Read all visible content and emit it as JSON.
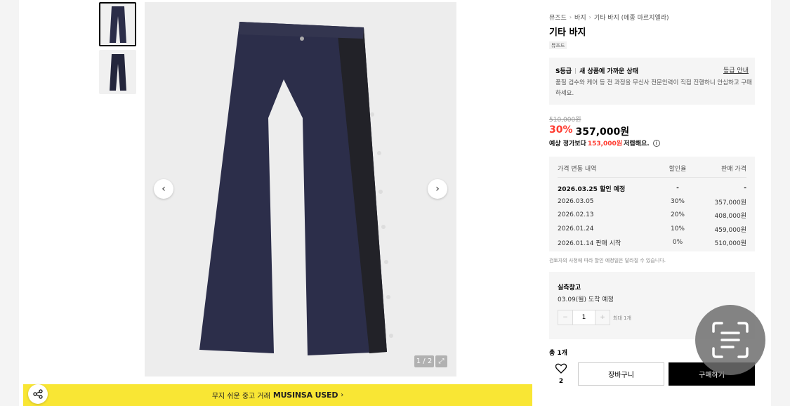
{
  "gallery": {
    "counter": "1 / 2",
    "banner_prefix": "무지 쉬운 중고 거래",
    "banner_brand": "MUSINSA USED",
    "banner_arrow": "›"
  },
  "product": {
    "breadcrumb": [
      "뮤즈드",
      "바지",
      "기타 바지 (메종 마르지엘라)"
    ],
    "title": "기타 바지",
    "brand_badge": "뮤즈드",
    "grade": {
      "level": "S등급",
      "summary": "새 상품에 가까운 상태",
      "guide_link": "등급 안내",
      "description": "품질 검수와 케어 등 전 과정을 무신사 전문인력이 직접 진행하니 안심하고 구매하세요."
    },
    "original_price": "510,000원",
    "discount": "30%",
    "sale_price": "357,000원",
    "expect_prefix": "예상 정가보다",
    "expect_amount": "153,000원",
    "expect_suffix": "저렴해요."
  },
  "price_history": {
    "headers": [
      "가격 변동 내역",
      "할인율",
      "판매 가격"
    ],
    "rows": [
      {
        "date": "2026.03.25 할인 예정",
        "rate": "-",
        "price": "-"
      },
      {
        "date": "2026.03.05",
        "rate": "30%",
        "price": "357,000원"
      },
      {
        "date": "2026.02.13",
        "rate": "20%",
        "price": "408,000원"
      },
      {
        "date": "2026.01.24",
        "rate": "10%",
        "price": "459,000원"
      },
      {
        "date": "2026.01.14 판매 시작",
        "rate": "0%",
        "price": "510,000원"
      }
    ],
    "note": "검토자의 사정에 따라 할인 예정일은 달라질 수 있습니다."
  },
  "stock": {
    "title": "실측창고",
    "arrival": "03.09(월) 도착 예정",
    "quantity": "1",
    "minus": "−",
    "plus": "+",
    "max_note": "최대 1개"
  },
  "purchase": {
    "total": "총 1개",
    "like_count": "2",
    "cart_label": "장바구니",
    "buy_label": "구매하기"
  },
  "colors": {
    "accent_red": "#ff3b30",
    "banner_yellow": "#f9e634",
    "buy_black": "#000000"
  }
}
